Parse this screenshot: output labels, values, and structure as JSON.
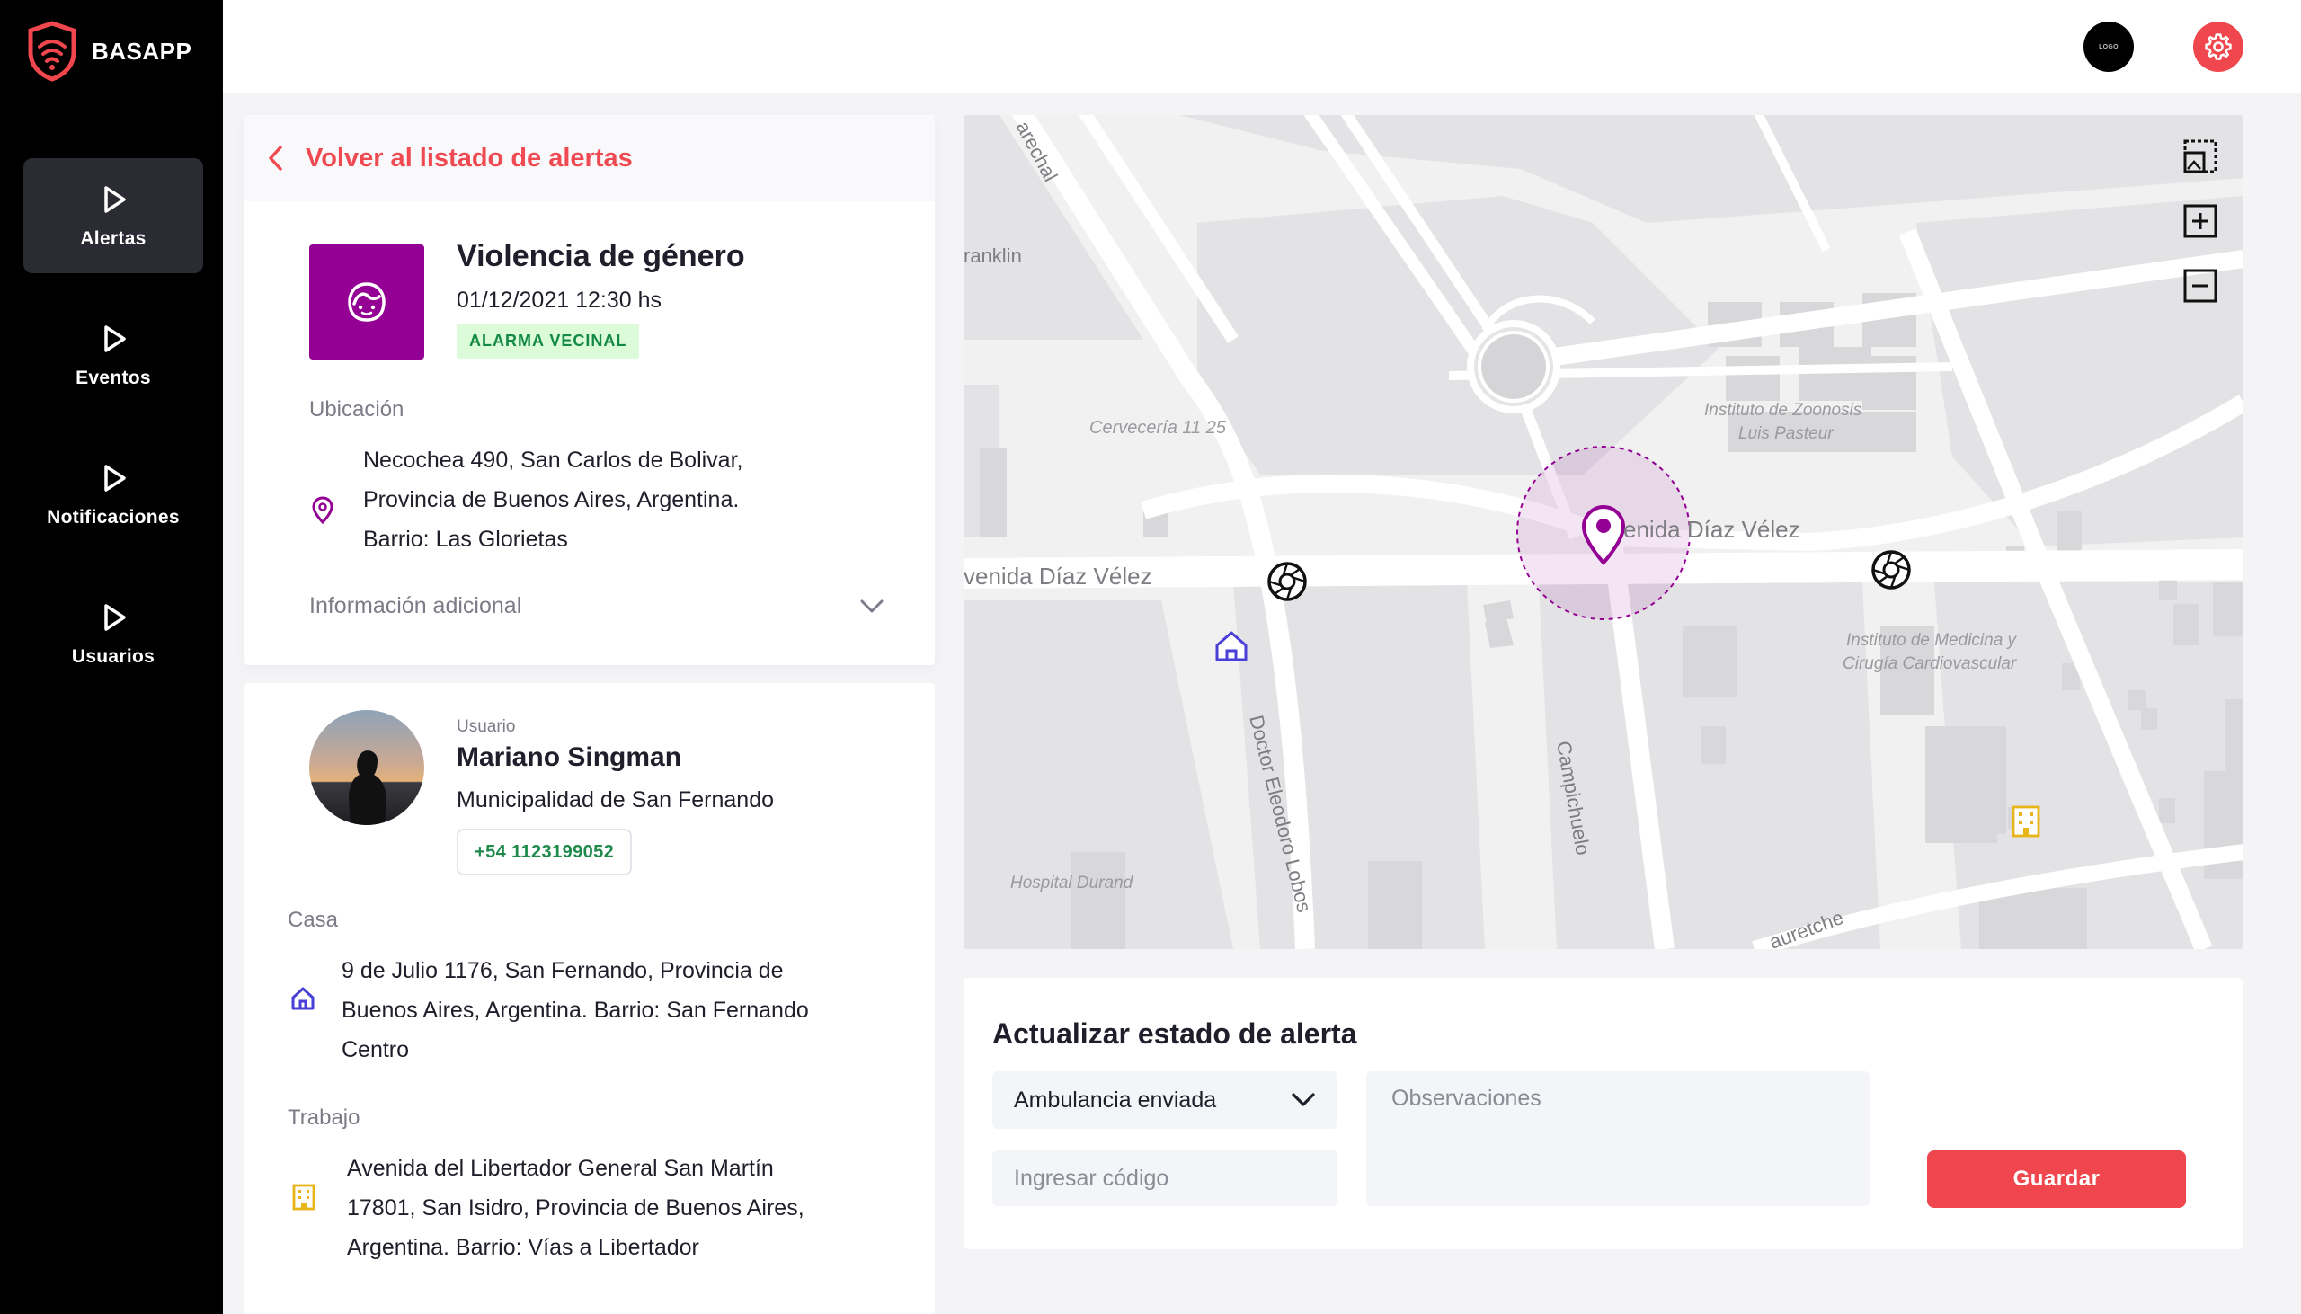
{
  "app": {
    "brand": "BASAPP"
  },
  "sidebar": {
    "items": [
      {
        "label": "Alertas",
        "active": true
      },
      {
        "label": "Eventos",
        "active": false
      },
      {
        "label": "Notificaciones",
        "active": false
      },
      {
        "label": "Usuarios",
        "active": false
      }
    ]
  },
  "topbar": {
    "avatar_text": "LOGO"
  },
  "alert": {
    "back_label": "Volver al listado de alertas",
    "title": "Violencia de género",
    "datetime": "01/12/2021 12:30 hs",
    "badge": "ALARMA VECINAL",
    "location_label": "Ubicación",
    "address_lines": [
      "Necochea 490, San Carlos de Bolivar,",
      "Provincia de Buenos Aires, Argentina.",
      "Barrio: Las Glorietas"
    ],
    "more_info_label": "Información adicional",
    "icon_color": "#930093"
  },
  "user": {
    "small_label": "Usuario",
    "name": "Mariano Singman",
    "org": "Municipalidad de San Fernando",
    "phone": "+54 1123199052",
    "home_label": "Casa",
    "home_lines": [
      "9 de Julio 1176, San Fernando, Provincia de",
      "Buenos Aires, Argentina. Barrio: San Fernando",
      "Centro"
    ],
    "work_label": "Trabajo",
    "work_lines": [
      "Avenida del Libertador General San Martín",
      "17801, San Isidro, Provincia de Buenos Aires,",
      "Argentina. Barrio: Vías a Libertador"
    ]
  },
  "map": {
    "labels": {
      "arechal": "arechal",
      "franklin": "ranklin",
      "cerveceria": "Cervecería 11 25",
      "zoonosis_1": "Instituto de Zoonosis",
      "zoonosis_2": "Luis Pasteur",
      "diaz_velez_right": "enida Díaz Vélez",
      "diaz_velez_left": "venida Díaz Vélez",
      "medicina_1": "Instituto de Medicina y",
      "medicina_2": "Cirugía Cardiovascular",
      "eleodoro": "Doctor Eleodoro Lobos",
      "campichuelo": "Campichuelo",
      "hospital": "Hospital Durand",
      "jauretche": "auretche"
    }
  },
  "update": {
    "title": "Actualizar estado de alerta",
    "status_selected": "Ambulancia enviada",
    "code_placeholder": "Ingresar código",
    "obs_placeholder": "Observaciones",
    "save_label": "Guardar"
  },
  "colors": {
    "accent": "#f0464d",
    "purple": "#930093",
    "badge_bg": "#dcfbd8",
    "badge_text": "#138a43",
    "home_icon": "#4a3fd6",
    "work_icon": "#e8b416"
  }
}
